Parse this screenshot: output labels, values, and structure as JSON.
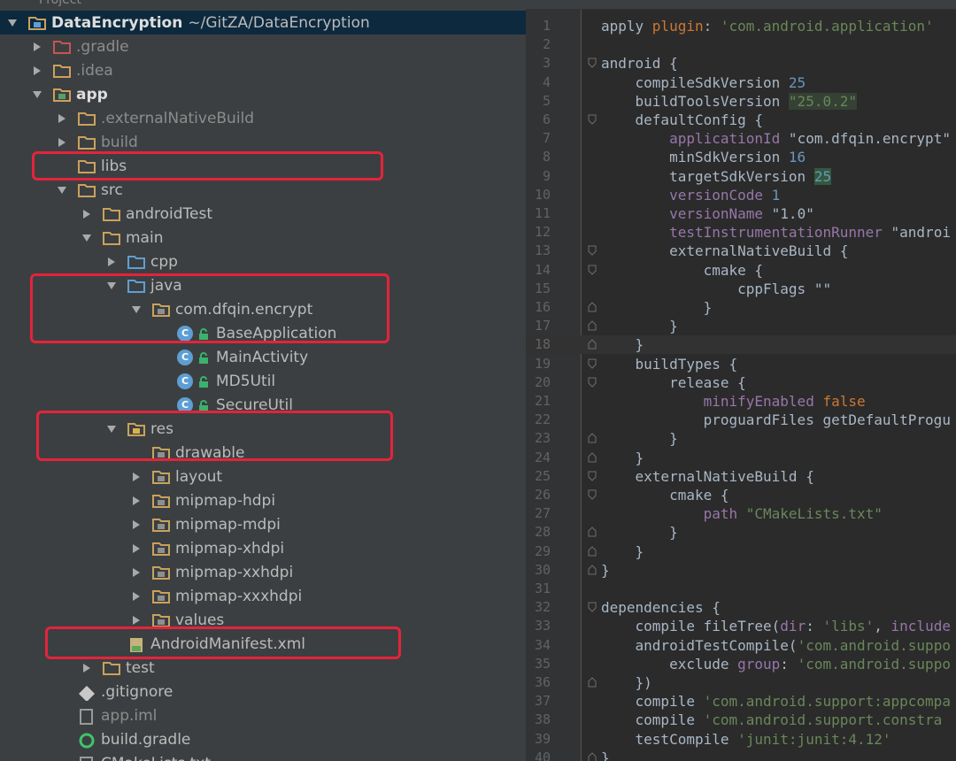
{
  "tree": {
    "header_label": "Project",
    "root": {
      "name": "DataEncryption",
      "path": "~/GitZA/DataEncryption"
    },
    "items": [
      {
        "label": ".gradle",
        "style": "dim"
      },
      {
        "label": ".idea",
        "style": "dim"
      },
      {
        "label": "app",
        "style": "bold"
      },
      {
        "label": ".externalNativeBuild",
        "style": "dim"
      },
      {
        "label": "build",
        "style": "dim"
      },
      {
        "label": "libs",
        "style": ""
      },
      {
        "label": "src",
        "style": ""
      },
      {
        "label": "androidTest",
        "style": ""
      },
      {
        "label": "main",
        "style": ""
      },
      {
        "label": "cpp",
        "style": ""
      },
      {
        "label": "java",
        "style": ""
      },
      {
        "label": "com.dfqin.encrypt",
        "style": ""
      },
      {
        "label": "BaseApplication",
        "style": ""
      },
      {
        "label": "MainActivity",
        "style": ""
      },
      {
        "label": "MD5Util",
        "style": ""
      },
      {
        "label": "SecureUtil",
        "style": ""
      },
      {
        "label": "res",
        "style": ""
      },
      {
        "label": "drawable",
        "style": ""
      },
      {
        "label": "layout",
        "style": ""
      },
      {
        "label": "mipmap-hdpi",
        "style": ""
      },
      {
        "label": "mipmap-mdpi",
        "style": ""
      },
      {
        "label": "mipmap-xhdpi",
        "style": ""
      },
      {
        "label": "mipmap-xxhdpi",
        "style": ""
      },
      {
        "label": "mipmap-xxxhdpi",
        "style": ""
      },
      {
        "label": "values",
        "style": ""
      },
      {
        "label": "AndroidManifest.xml",
        "style": ""
      },
      {
        "label": "test",
        "style": ""
      },
      {
        "label": ".gitignore",
        "style": ""
      },
      {
        "label": "app.iml",
        "style": "dim"
      },
      {
        "label": "build.gradle",
        "style": ""
      },
      {
        "label": "CMakeLists.txt",
        "style": ""
      }
    ],
    "class_badge": "C",
    "highlight_color": "#e5233b"
  },
  "editor": {
    "line_numbers": [
      "1",
      "2",
      "3",
      "4",
      "5",
      "6",
      "7",
      "8",
      "9",
      "10",
      "11",
      "12",
      "13",
      "14",
      "15",
      "16",
      "17",
      "18",
      "19",
      "20",
      "21",
      "22",
      "23",
      "24",
      "25",
      "26",
      "27",
      "28",
      "29",
      "30",
      "31",
      "32",
      "33",
      "34",
      "35",
      "36",
      "37",
      "38",
      "39",
      "40"
    ],
    "code": [
      [
        {
          "t": "apply ",
          "c": ""
        },
        {
          "t": "plugin",
          "c": "kw"
        },
        {
          "t": ": ",
          "c": ""
        },
        {
          "t": "'com.android.application'",
          "c": "s"
        }
      ],
      [],
      [
        {
          "t": "android {",
          "c": ""
        }
      ],
      [
        {
          "t": "    compileSdkVersion ",
          "c": ""
        },
        {
          "t": "25",
          "c": "n"
        }
      ],
      [
        {
          "t": "    buildToolsVersion ",
          "c": ""
        },
        {
          "t": "\"25.0.2\"",
          "c": "s hlbox"
        }
      ],
      [
        {
          "t": "    defaultConfig {",
          "c": ""
        }
      ],
      [
        {
          "t": "        ",
          "c": ""
        },
        {
          "t": "applicationId",
          "c": "p"
        },
        {
          "t": " \"com.dfqin.encrypt\"",
          "c": ""
        }
      ],
      [
        {
          "t": "        minSdkVersion ",
          "c": ""
        },
        {
          "t": "16",
          "c": "n"
        }
      ],
      [
        {
          "t": "        targetSdkVersion ",
          "c": ""
        },
        {
          "t": "25",
          "c": "n hlnum"
        }
      ],
      [
        {
          "t": "        ",
          "c": ""
        },
        {
          "t": "versionCode",
          "c": "p"
        },
        {
          "t": " ",
          "c": ""
        },
        {
          "t": "1",
          "c": "n"
        }
      ],
      [
        {
          "t": "        ",
          "c": ""
        },
        {
          "t": "versionName",
          "c": "p"
        },
        {
          "t": " \"1.0\"",
          "c": ""
        }
      ],
      [
        {
          "t": "        ",
          "c": ""
        },
        {
          "t": "testInstrumentationRunner",
          "c": "p"
        },
        {
          "t": " \"androi",
          "c": ""
        }
      ],
      [
        {
          "t": "        externalNativeBuild {",
          "c": ""
        }
      ],
      [
        {
          "t": "            cmake {",
          "c": ""
        }
      ],
      [
        {
          "t": "                cppFlags \"\"",
          "c": ""
        }
      ],
      [
        {
          "t": "            }",
          "c": ""
        }
      ],
      [
        {
          "t": "        }",
          "c": ""
        }
      ],
      [
        {
          "t": "    }",
          "c": ""
        }
      ],
      [
        {
          "t": "    buildTypes {",
          "c": ""
        }
      ],
      [
        {
          "t": "        release {",
          "c": ""
        }
      ],
      [
        {
          "t": "            ",
          "c": ""
        },
        {
          "t": "minifyEnabled",
          "c": "p"
        },
        {
          "t": " ",
          "c": ""
        },
        {
          "t": "false",
          "c": "kw"
        }
      ],
      [
        {
          "t": "            proguardFiles getDefaultProgu",
          "c": ""
        }
      ],
      [
        {
          "t": "        }",
          "c": ""
        }
      ],
      [
        {
          "t": "    }",
          "c": ""
        }
      ],
      [
        {
          "t": "    externalNativeBuild {",
          "c": ""
        }
      ],
      [
        {
          "t": "        cmake {",
          "c": ""
        }
      ],
      [
        {
          "t": "            ",
          "c": ""
        },
        {
          "t": "path",
          "c": "p"
        },
        {
          "t": " \"CMakeLists.txt\"",
          "c": "s"
        }
      ],
      [
        {
          "t": "        }",
          "c": ""
        }
      ],
      [
        {
          "t": "    }",
          "c": ""
        }
      ],
      [
        {
          "t": "}",
          "c": ""
        }
      ],
      [],
      [
        {
          "t": "dependencies {",
          "c": ""
        }
      ],
      [
        {
          "t": "    compile fileTree(",
          "c": ""
        },
        {
          "t": "dir",
          "c": "p"
        },
        {
          "t": ": ",
          "c": ""
        },
        {
          "t": "'libs'",
          "c": "s"
        },
        {
          "t": ", ",
          "c": ""
        },
        {
          "t": "include",
          "c": "p"
        }
      ],
      [
        {
          "t": "    androidTestCompile(",
          "c": ""
        },
        {
          "t": "'com.android.suppo",
          "c": "s"
        }
      ],
      [
        {
          "t": "        exclude ",
          "c": ""
        },
        {
          "t": "group",
          "c": "p"
        },
        {
          "t": ": ",
          "c": ""
        },
        {
          "t": "'com.android.suppo",
          "c": "s"
        }
      ],
      [
        {
          "t": "    })",
          "c": ""
        }
      ],
      [
        {
          "t": "    compile ",
          "c": ""
        },
        {
          "t": "'com.android.support:appcompa",
          "c": "s"
        }
      ],
      [
        {
          "t": "    compile ",
          "c": ""
        },
        {
          "t": "'com.android.support.constra",
          "c": "s"
        }
      ],
      [
        {
          "t": "    testCompile ",
          "c": ""
        },
        {
          "t": "'junit:junit:4.12'",
          "c": "s"
        }
      ],
      [
        {
          "t": "}",
          "c": ""
        }
      ]
    ]
  }
}
